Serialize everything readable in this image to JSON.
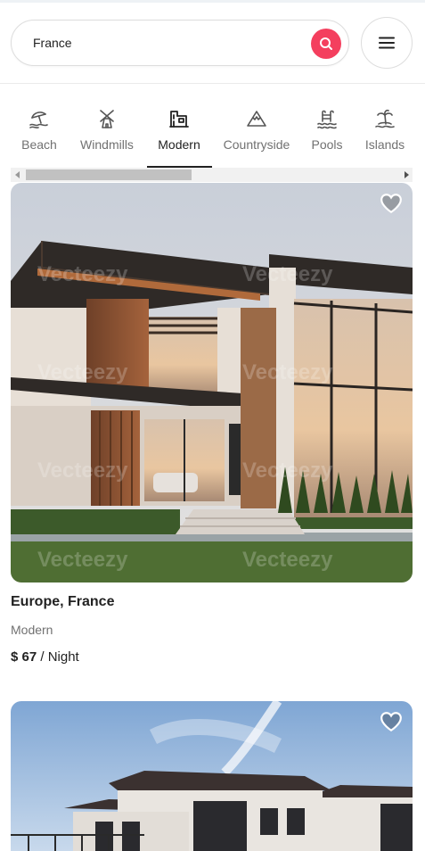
{
  "search": {
    "value": "France",
    "button_icon": "search-icon",
    "accent": "#f43f5e"
  },
  "menu": {
    "icon": "hamburger-menu-icon"
  },
  "categories": [
    {
      "label": "Beach",
      "icon": "beach-umbrella-icon",
      "active": false
    },
    {
      "label": "Windmills",
      "icon": "windmill-icon",
      "active": false
    },
    {
      "label": "Modern",
      "icon": "modern-building-icon",
      "active": true
    },
    {
      "label": "Countryside",
      "icon": "mountain-icon",
      "active": false
    },
    {
      "label": "Pools",
      "icon": "pool-ladder-icon",
      "active": false
    },
    {
      "label": "Islands",
      "icon": "palm-island-icon",
      "active": false
    }
  ],
  "listings": [
    {
      "location": "Europe, France",
      "category": "Modern",
      "price": "$ 67",
      "price_unit": "/ Night",
      "favorite_icon": "heart-icon"
    },
    {
      "favorite_icon": "heart-icon"
    }
  ],
  "watermark": "Vecteezy"
}
